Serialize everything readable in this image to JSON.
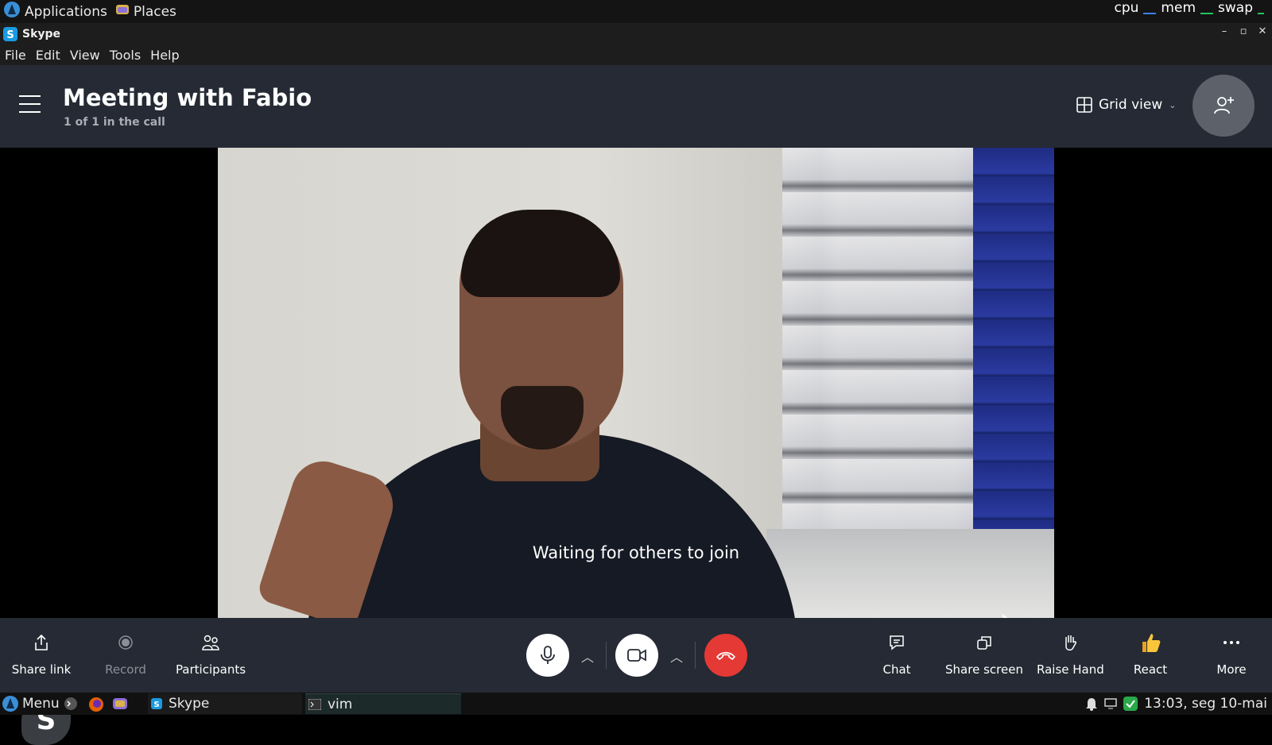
{
  "system_panel": {
    "applications_label": "Applications",
    "places_label": "Places",
    "monitors": [
      {
        "label": "cpu",
        "color": "#3b82f6"
      },
      {
        "label": "mem",
        "color": "#22c55e"
      },
      {
        "label": "swap",
        "color": "#22c55e"
      }
    ]
  },
  "window": {
    "title": "Skype",
    "menu": [
      "File",
      "Edit",
      "View",
      "Tools",
      "Help"
    ]
  },
  "header": {
    "title": "Meeting with Fabio",
    "subtitle": "1 of 1 in the call",
    "view_label": "Grid view"
  },
  "stage": {
    "status_text": "Waiting for others to join",
    "badge_letter": "S"
  },
  "controls": {
    "left": [
      {
        "label": "Share link",
        "icon": "share-icon",
        "enabled": true
      },
      {
        "label": "Record",
        "icon": "record-icon",
        "enabled": false
      },
      {
        "label": "Participants",
        "icon": "participants-icon",
        "enabled": true
      }
    ],
    "right": [
      {
        "label": "Chat",
        "icon": "chat-icon"
      },
      {
        "label": "Share screen",
        "icon": "share-screen-icon"
      },
      {
        "label": "Raise Hand",
        "icon": "raise-hand-icon"
      },
      {
        "label": "React",
        "icon": "thumbs-up-icon"
      },
      {
        "label": "More",
        "icon": "more-icon"
      }
    ],
    "hangup_color": "#e53935"
  },
  "taskbar": {
    "menu_label": "Menu",
    "skype_label": "Skype",
    "vim_label": "vim",
    "clock": "13:03, seg 10-mai"
  }
}
